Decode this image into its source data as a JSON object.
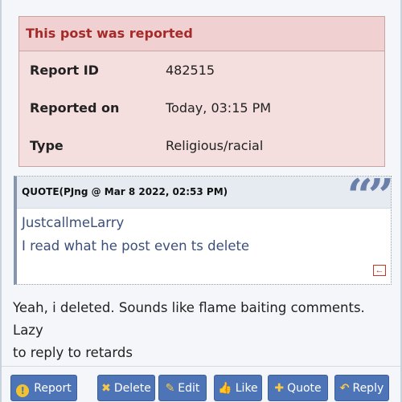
{
  "report": {
    "header": "This post was reported",
    "rows": [
      {
        "label": "Report ID",
        "value": "482515"
      },
      {
        "label": "Reported on",
        "value": "Today, 03:15 PM"
      },
      {
        "label": "Type",
        "value": "Religious/racial"
      }
    ]
  },
  "quote": {
    "header": "QUOTE(PJng @ Mar 8 2022, 02:53 PM)",
    "mark": "66 99",
    "lines": [
      "JustcallmeLarry",
      "I read what he post even ts delete"
    ]
  },
  "post": {
    "line1": "Yeah, i deleted. Sounds like flame baiting comments. Lazy",
    "line2": "to reply to retards"
  },
  "buttons": {
    "report": "Report",
    "delete": "Delete",
    "edit": "Edit",
    "like": "Like",
    "quote": "Quote",
    "reply": "Reply"
  },
  "colors": {
    "button": "#4e74b8",
    "report_header": "#a52a2a",
    "report_bg": "#f4dede",
    "icon_yellow": "#f7c948"
  },
  "icons": {
    "report": "exclamation-icon",
    "delete": "x-icon",
    "edit": "pencil-icon",
    "like": "thumbs-up-icon",
    "quote": "plus-icon",
    "reply": "reply-arrow-icon",
    "back": "back-arrow-icon"
  }
}
